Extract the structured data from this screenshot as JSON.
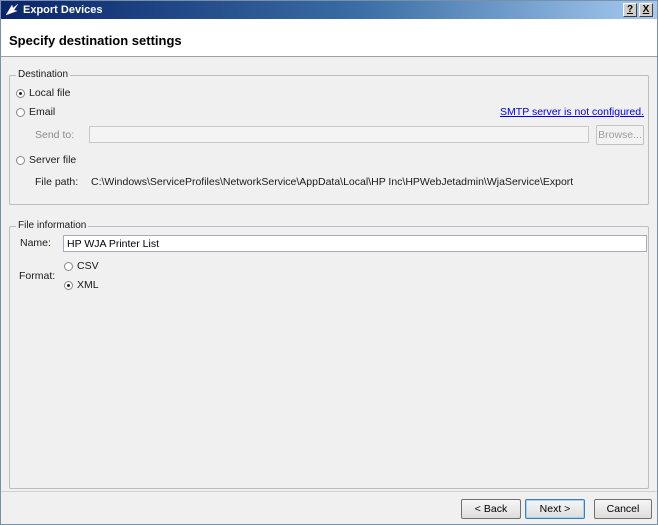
{
  "window": {
    "title": "Export Devices",
    "help_button": "?",
    "close_button": "X"
  },
  "header": {
    "title": "Specify destination settings"
  },
  "destination": {
    "legend": "Destination",
    "local_file_label": "Local file",
    "local_file_selected": true,
    "email_label": "Email",
    "email_selected": false,
    "smtp_link": "SMTP server is not configured.",
    "send_to_label": "Send to:",
    "send_to_value": "",
    "browse_label": "Browse...",
    "server_file_label": "Server file",
    "server_file_selected": false,
    "file_path_label": "File path:",
    "file_path_value": "C:\\Windows\\ServiceProfiles\\NetworkService\\AppData\\Local\\HP Inc\\HPWebJetadmin\\WjaService\\Export"
  },
  "file_information": {
    "legend": "File information",
    "name_label": "Name:",
    "name_value": "HP WJA Printer List",
    "format_label": "Format:",
    "csv_label": "CSV",
    "csv_selected": false,
    "xml_label": "XML",
    "xml_selected": true
  },
  "footer": {
    "back_label": "< Back",
    "next_label": "Next >",
    "cancel_label": "Cancel"
  },
  "colors": {
    "title_gradient_start": "#0a246a",
    "title_gradient_end": "#a6caf0",
    "link": "#0000ee",
    "dialog_bg": "#f0f0f0"
  },
  "icons": {
    "title": "export-arrow-icon"
  }
}
